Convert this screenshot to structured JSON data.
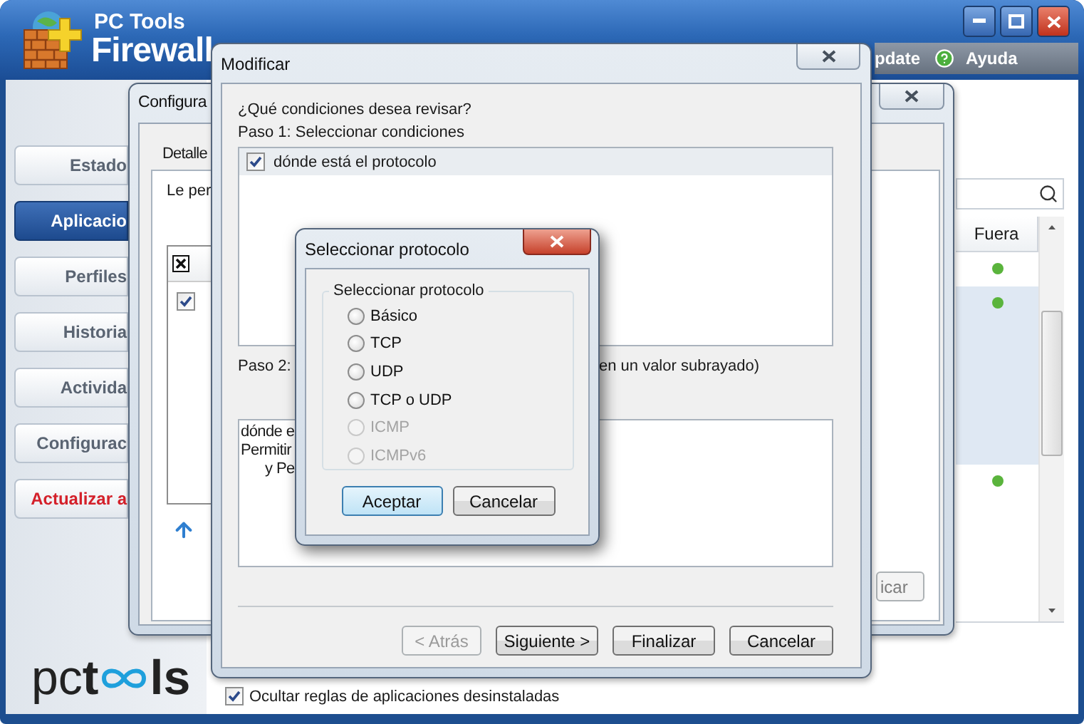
{
  "main": {
    "title_top": "PC Tools",
    "title_main": "Firewall",
    "menu": [
      {
        "kind": "link",
        "label": "pdate"
      },
      {
        "kind": "help",
        "label": "Ayuda"
      }
    ],
    "nav": [
      {
        "label": "Estado",
        "selected": false,
        "kind": "normal"
      },
      {
        "label": "Aplicacio",
        "selected": true,
        "kind": "normal"
      },
      {
        "label": "Perfiles",
        "selected": false,
        "kind": "normal"
      },
      {
        "label": "Historia",
        "selected": false,
        "kind": "normal"
      },
      {
        "label": "Activida",
        "selected": false,
        "kind": "normal"
      },
      {
        "label": "Configurac",
        "selected": false,
        "kind": "normal"
      },
      {
        "label": "Actualizar a",
        "selected": false,
        "kind": "alert"
      }
    ],
    "logo": [
      "pc**t**",
      "ls"
    ],
    "table": {
      "columns": [
        "Fuera"
      ],
      "rows": [
        {
          "selected": false
        },
        {
          "selected": true
        },
        {
          "selected": false
        }
      ]
    },
    "hide_uninstalled": {
      "label": "Ocultar reglas de aplicaciones desinstaladas",
      "checked": true
    }
  },
  "settings_window": {
    "title": "Configura",
    "tab": "Detalle",
    "intro": "Le per",
    "rows": [
      {
        "checked": true
      }
    ],
    "button": {
      "label": "icar",
      "disabled": true
    }
  },
  "modify_window": {
    "title": "Modificar",
    "question": "¿Qué condiciones desea revisar?",
    "step1": "Paso 1: Seleccionar condiciones",
    "conditions": [
      {
        "label": "dónde está el protocolo",
        "checked": true,
        "selected": true
      }
    ],
    "step2": [
      "Paso 2:",
      "en un valor subrayado)"
    ],
    "description": [
      {
        "text": "dónde e",
        "indented": false
      },
      {
        "text": "Permitir",
        "indented": false
      },
      {
        "text": "y Pe",
        "indented": true
      }
    ],
    "buttons": [
      {
        "label": "< Atrás",
        "disabled": true
      },
      {
        "label": "Siguiente >",
        "disabled": false
      },
      {
        "label": "Finalizar",
        "disabled": false
      },
      {
        "label": "Cancelar",
        "disabled": false
      }
    ]
  },
  "protocol_dialog": {
    "title": "Seleccionar protocolo",
    "group": "Seleccionar protocolo",
    "options": [
      {
        "label": "Básico",
        "selected": false,
        "disabled": false
      },
      {
        "label": "TCP",
        "selected": false,
        "disabled": false
      },
      {
        "label": "UDP",
        "selected": false,
        "disabled": false
      },
      {
        "label": "TCP o UDP",
        "selected": false,
        "disabled": false
      },
      {
        "label": "ICMP",
        "selected": false,
        "disabled": true
      },
      {
        "label": "ICMPv6",
        "selected": false,
        "disabled": true
      }
    ],
    "buttons": [
      {
        "label": "Aceptar",
        "default": true
      },
      {
        "label": "Cancelar",
        "default": false
      }
    ]
  }
}
